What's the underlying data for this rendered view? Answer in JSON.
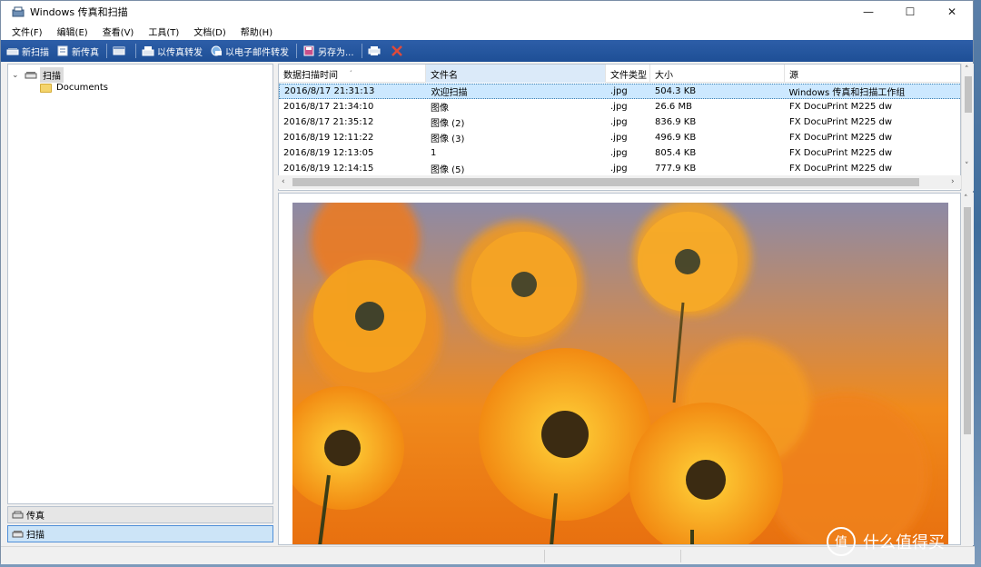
{
  "window": {
    "title": "Windows 传真和扫描",
    "controls": {
      "minimize": "—",
      "maximize": "☐",
      "close": "✕"
    }
  },
  "menu": [
    {
      "label": "文件(F)"
    },
    {
      "label": "编辑(E)"
    },
    {
      "label": "查看(V)"
    },
    {
      "label": "工具(T)"
    },
    {
      "label": "文档(D)"
    },
    {
      "label": "帮助(H)"
    }
  ],
  "toolbar": {
    "new_scan": "新扫描",
    "new_fax": "新传真",
    "forward_fax": "以传真转发",
    "forward_email": "以电子邮件转发",
    "save_as": "另存为..."
  },
  "tree": {
    "root": "扫描",
    "child": "Documents"
  },
  "nav": {
    "fax": "传真",
    "scan": "扫描"
  },
  "list": {
    "columns": [
      "数据扫描时间",
      "文件名",
      "文件类型",
      "大小",
      "源"
    ],
    "sort_indicator": "ˊ",
    "rows": [
      {
        "time": "2016/8/17 21:31:13",
        "name": "欢迎扫描",
        "type": ".jpg",
        "size": "504.3 KB",
        "source": "Windows 传真和扫描工作组"
      },
      {
        "time": "2016/8/17 21:34:10",
        "name": "图像",
        "type": ".jpg",
        "size": "26.6 MB",
        "source": "FX DocuPrint M225 dw"
      },
      {
        "time": "2016/8/17 21:35:12",
        "name": "图像 (2)",
        "type": ".jpg",
        "size": "836.9 KB",
        "source": "FX DocuPrint M225 dw"
      },
      {
        "time": "2016/8/19 12:11:22",
        "name": "图像 (3)",
        "type": ".jpg",
        "size": "496.9 KB",
        "source": "FX DocuPrint M225 dw"
      },
      {
        "time": "2016/8/19 12:13:05",
        "name": "1",
        "type": ".jpg",
        "size": "805.4 KB",
        "source": "FX DocuPrint M225 dw"
      },
      {
        "time": "2016/8/19 12:14:15",
        "name": "图像 (5)",
        "type": ".jpg",
        "size": "777.9 KB",
        "source": "FX DocuPrint M225 dw"
      }
    ]
  },
  "watermark": {
    "badge": "值",
    "text": "什么值得买"
  },
  "colors": {
    "toolbar": "#2358a3",
    "selection": "#cce8ff",
    "flower_orange": "#f39a1b",
    "flower_center": "#3b2b12"
  }
}
